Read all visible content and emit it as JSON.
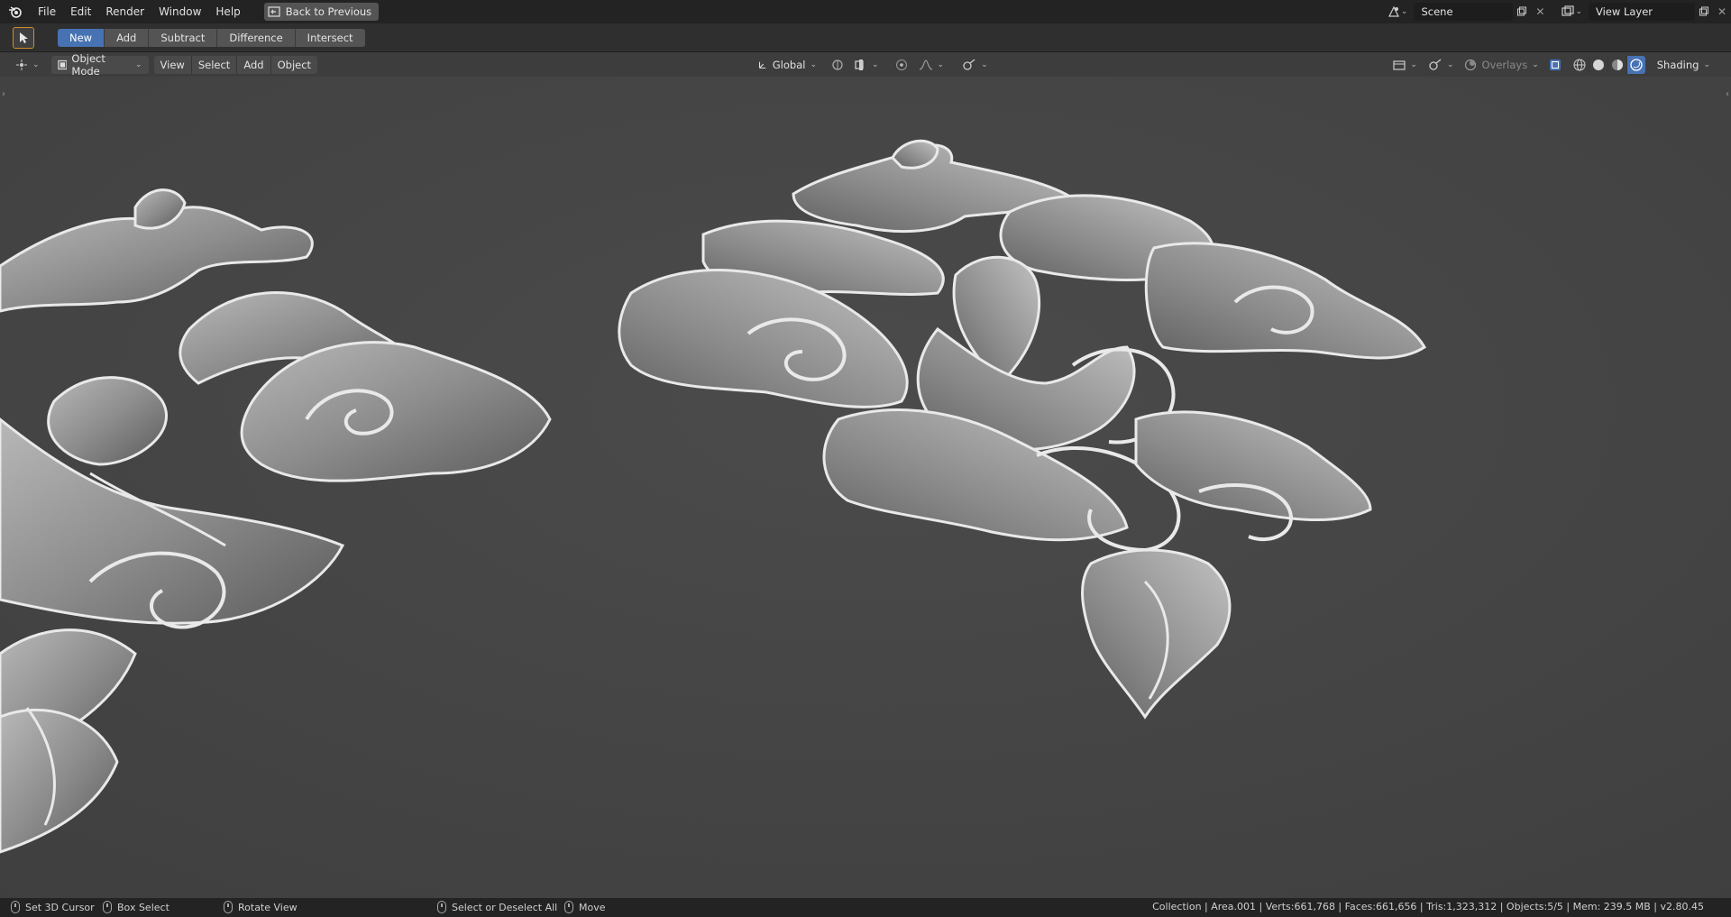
{
  "topbar": {
    "menus": [
      "File",
      "Edit",
      "Render",
      "Window",
      "Help"
    ],
    "back_button": "Back to Previous",
    "scene_name": "Scene",
    "view_layer_name": "View Layer"
  },
  "tool_settings": {
    "modes": [
      "New",
      "Add",
      "Subtract",
      "Difference",
      "Intersect"
    ],
    "active_mode": "New"
  },
  "viewport_header": {
    "mode": "Object Mode",
    "menus": [
      "View",
      "Select",
      "Add",
      "Object"
    ],
    "transform_orientation": "Global",
    "overlays_label": "Overlays",
    "shading_label": "Shading"
  },
  "statusbar": {
    "hints": [
      "Set 3D Cursor",
      "Box Select",
      "Rotate View",
      "Select or Deselect All",
      "Move"
    ],
    "stats": "Collection | Area.001 | Verts:661,768 | Faces:661,656 | Tris:1,323,312 | Objects:5/5 | Mem: 239.5 MB | v2.80.45"
  },
  "colors": {
    "accent": "#4772b3",
    "active_tool_outline": "#d08c2a",
    "viewport_bg": "#454545"
  }
}
